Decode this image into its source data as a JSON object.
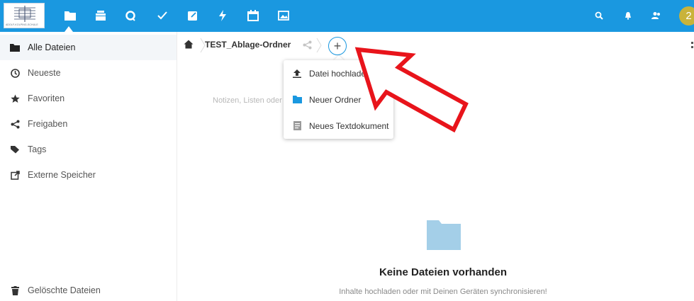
{
  "header": {
    "logo_text": "ADOLF-KOLPING-SCHULE",
    "brand_color": "#1a98e0",
    "apps": [
      {
        "name": "files",
        "icon": "folder-icon"
      },
      {
        "name": "deck",
        "icon": "stack-icon"
      },
      {
        "name": "talk",
        "icon": "talk-icon"
      },
      {
        "name": "tasks",
        "icon": "checkmark-icon"
      },
      {
        "name": "notes",
        "icon": "edit-icon"
      },
      {
        "name": "activity",
        "icon": "lightning-icon"
      },
      {
        "name": "calendar",
        "icon": "calendar-icon"
      },
      {
        "name": "gallery",
        "icon": "image-icon"
      }
    ],
    "avatar_text": "2"
  },
  "sidebar": {
    "items": [
      {
        "label": "Alle Dateien",
        "icon": "folder-icon"
      },
      {
        "label": "Neueste",
        "icon": "clock-icon"
      },
      {
        "label": "Favoriten",
        "icon": "star-icon"
      },
      {
        "label": "Freigaben",
        "icon": "share-icon"
      },
      {
        "label": "Tags",
        "icon": "tag-icon"
      },
      {
        "label": "Externe Speicher",
        "icon": "external-icon"
      }
    ],
    "trash_label": "Gelöschte Dateien"
  },
  "breadcrumb": {
    "folder": "TEST_Ablage-Ordner",
    "add_label": "+"
  },
  "menu": {
    "items": [
      {
        "label": "Datei hochladen",
        "icon": "upload-icon"
      },
      {
        "label": "Neuer Ordner",
        "icon": "folder-icon"
      },
      {
        "label": "Neues Textdokument",
        "icon": "text-document-icon"
      }
    ]
  },
  "content": {
    "notes_hint": "Notizen, Listen oder",
    "empty_title": "Keine Dateien vorhanden",
    "empty_subtitle": "Inhalte hochladen oder mit Deinen Geräten synchronisieren!"
  },
  "annotation": {
    "arrow_color": "#e8141b"
  }
}
